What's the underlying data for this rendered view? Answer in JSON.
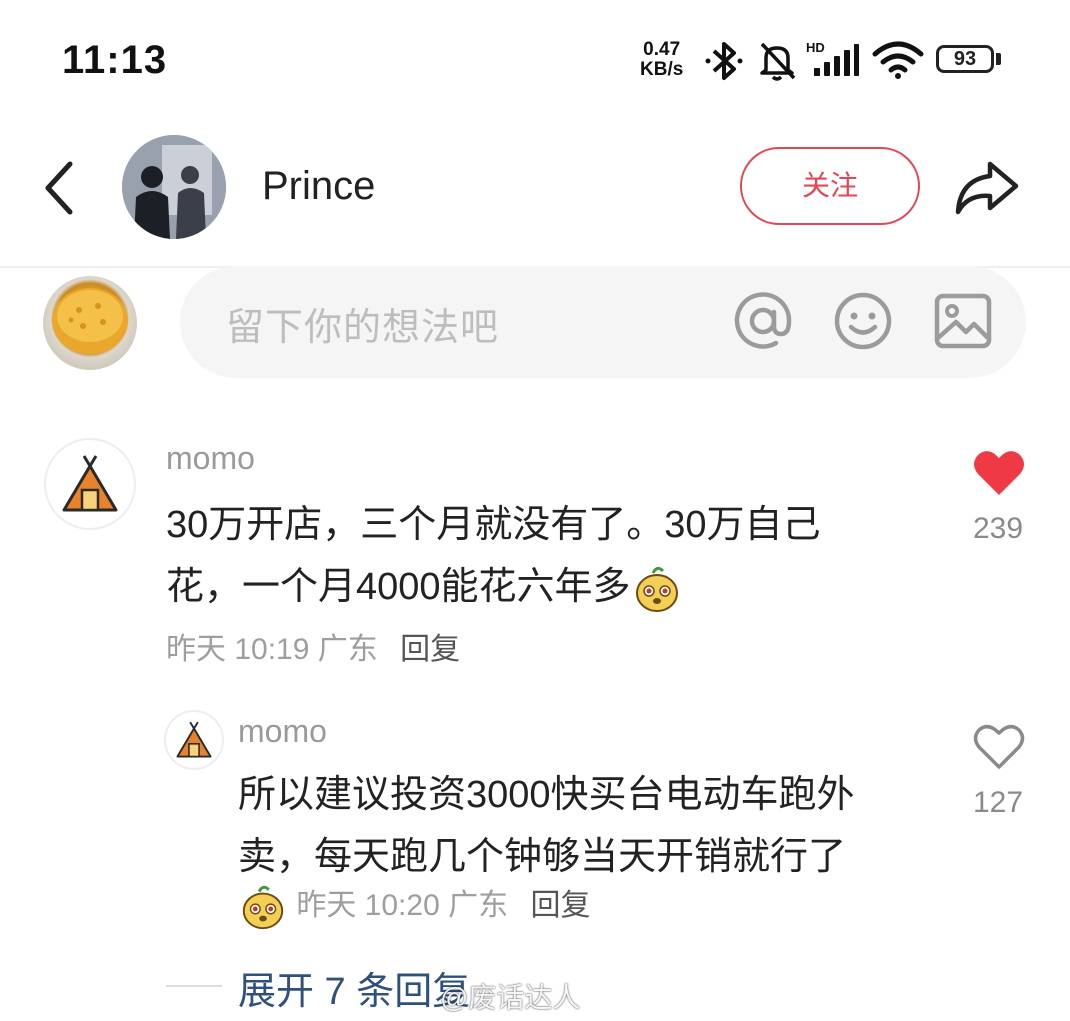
{
  "status_bar": {
    "time": "11:13",
    "net_speed_value": "0.47",
    "net_speed_unit": "KB/s",
    "network_tag": "HD",
    "battery": "93"
  },
  "header": {
    "author_name": "Prince",
    "follow_label": "关注"
  },
  "comment_input": {
    "placeholder": "留下你的想法吧"
  },
  "comments": [
    {
      "user": "momo",
      "text_line1": "30万开店，三个月就没有了。30万自己",
      "text_line2": "花，一个月4000能花六年多",
      "time": "昨天 10:19",
      "location": "广东",
      "reply_label": "回复",
      "likes": "239",
      "liked": true,
      "replies": [
        {
          "user": "momo",
          "text_line1": "所以建议投资3000快买台电动车跑外",
          "text_line2": "卖，每天跑几个钟够当天开销就行了",
          "time": "昨天 10:20",
          "location": "广东",
          "reply_label": "回复",
          "likes": "127",
          "liked": false
        }
      ]
    }
  ],
  "expand_replies_label": "展开 7 条回复",
  "watermark": "@废话达人",
  "colors": {
    "accent_red": "#e64553",
    "link_blue": "#30507c",
    "muted_gray": "#9e9e9e"
  }
}
